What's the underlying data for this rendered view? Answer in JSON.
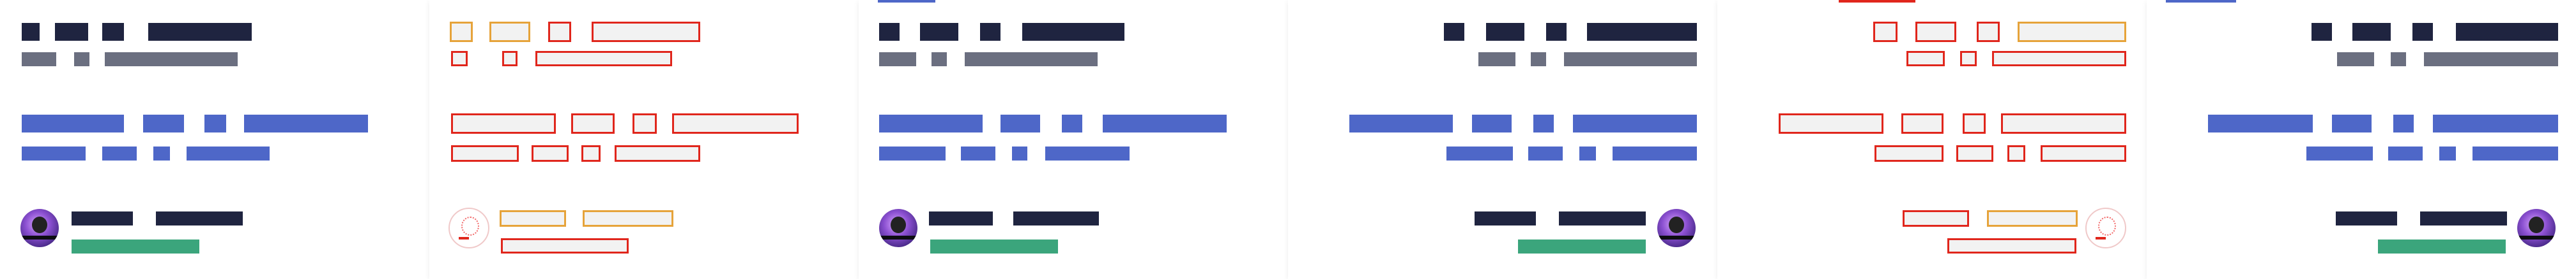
{
  "panels": [
    {
      "variant": "solid-left"
    },
    {
      "variant": "outline-left"
    },
    {
      "variant": "solid-left"
    },
    {
      "variant": "solid-right"
    },
    {
      "variant": "outline-right"
    },
    {
      "variant": "solid-right"
    }
  ],
  "colors": {
    "heading": "#1f2440",
    "subtext": "#6b6f80",
    "body": "#4e67c8",
    "status": "#3ba57c",
    "outline": "#e0261c"
  },
  "icons": [
    "avatar"
  ]
}
